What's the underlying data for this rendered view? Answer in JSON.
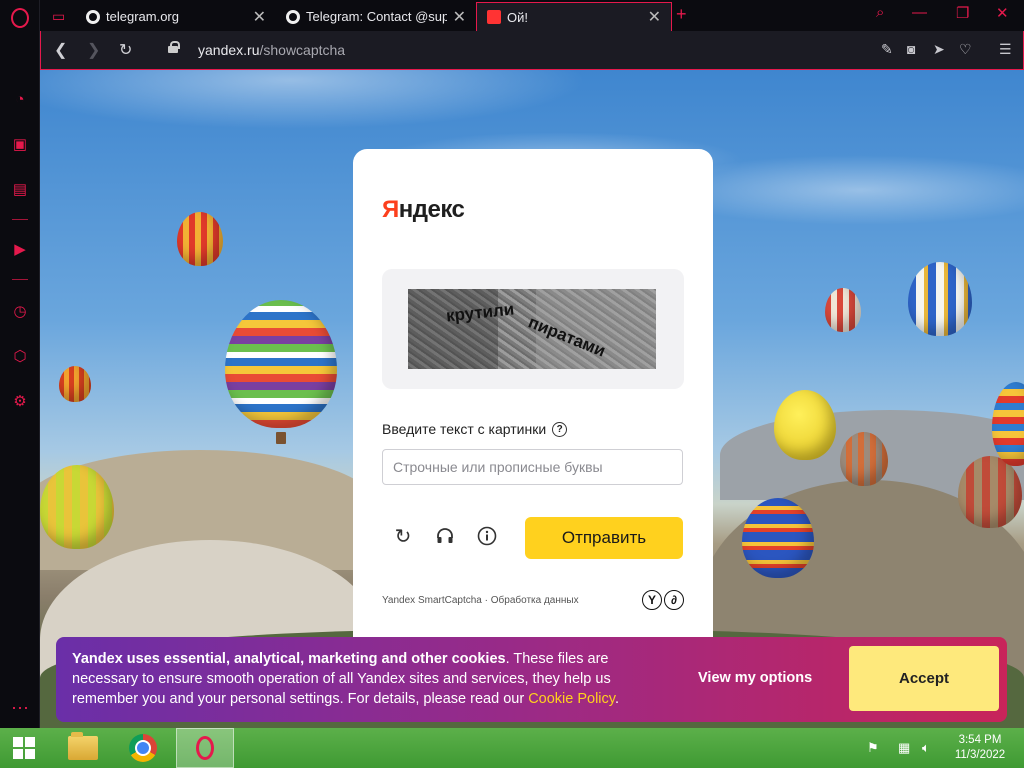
{
  "browser": {
    "tabs": [
      {
        "label": "",
        "icon": "gamepad-icon"
      },
      {
        "label": "telegram.org",
        "icon": "globe-icon"
      },
      {
        "label": "Telegram: Contact @supern",
        "icon": "globe-icon"
      },
      {
        "label": "Ой!",
        "icon": "yandex-icon"
      }
    ],
    "address": {
      "host": "yandex.ru",
      "path": "/showcaptcha"
    },
    "accent": "#e5194c"
  },
  "captcha": {
    "logo_first": "Я",
    "logo_rest": "ндекс",
    "captcha_word_1": "крутили",
    "captcha_word_2": "пиратами",
    "prompt": "Введите текст с картинки",
    "help": "?",
    "placeholder": "Строчные или прописные буквы",
    "submit": "Отправить",
    "footer": "Yandex SmartCaptcha · Обработка данных",
    "brand_color": "#fc3f1d",
    "button_color": "#ffd11e"
  },
  "cookie": {
    "bold": "Yandex uses essential, analytical, marketing and other cookies",
    "text": ". These files are necessary to ensure smooth operation of all Yandex sites and services, they help us remember you and your personal settings. For details, please read our ",
    "link": "Cookie Policy",
    "end": ".",
    "view_options": "View my options",
    "accept": "Accept"
  },
  "taskbar": {
    "time": "3:54 PM",
    "date": "11/3/2022"
  }
}
